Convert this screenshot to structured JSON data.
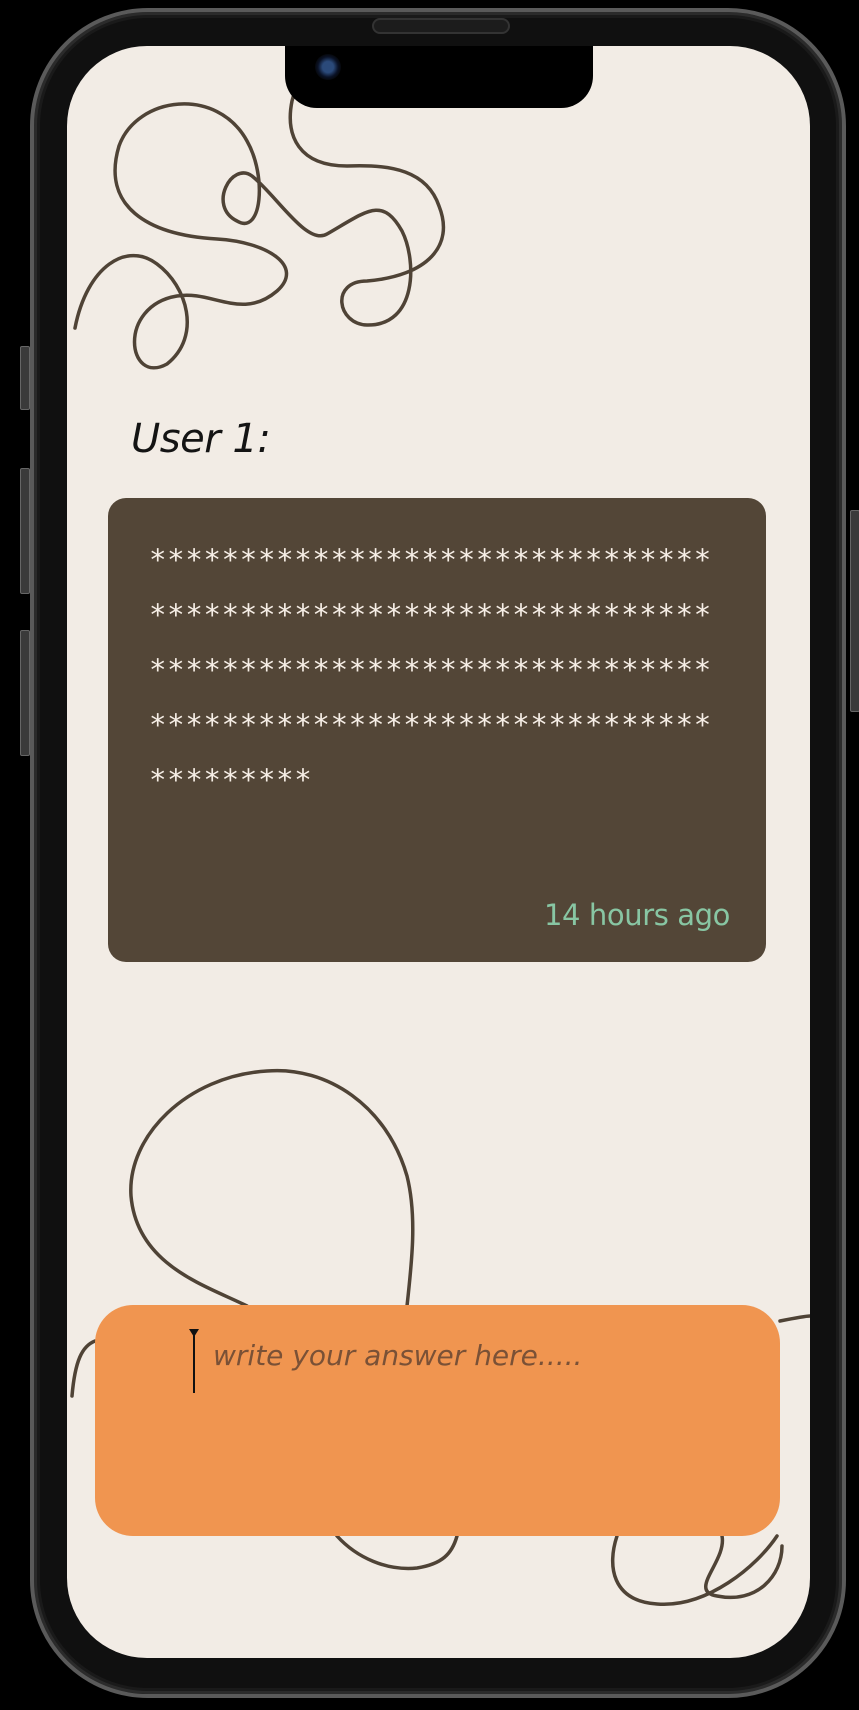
{
  "post": {
    "author_label": "User 1:",
    "body": "*************************************************************************************************************************************",
    "timestamp": "14 hours ago"
  },
  "answer": {
    "placeholder": "write your answer here.....",
    "value": ""
  },
  "colors": {
    "screen_background": "#f2ece5",
    "card_background": "#534637",
    "card_text": "#f6eee6",
    "timestamp": "#88c6a3",
    "answer_box": "#f09550",
    "squiggle_lines": "#4f4336"
  }
}
